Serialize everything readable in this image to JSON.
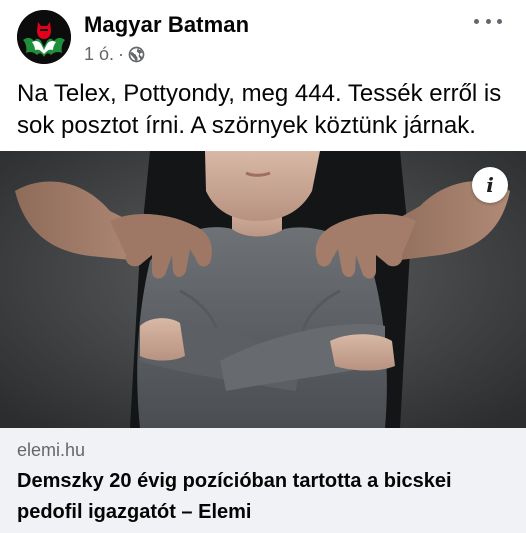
{
  "post": {
    "author": "Magyar Batman",
    "time": "1 ó.",
    "separator": "·",
    "privacy_icon": "globe-icon",
    "more_icon": "more-options-icon",
    "text": "Na Telex, Pottyondy, meg 444. Tessék erről is sok posztot írni. A szörnyek köztünk járnak."
  },
  "link_preview": {
    "image_description_icon": "info-icon",
    "info_glyph": "i",
    "domain": "elemi.hu",
    "title": "Demszky 20 évig pozícióban tartotta a bicskei pedofil igazgatót – Elemi"
  },
  "colors": {
    "text_primary": "#050505",
    "text_secondary": "#65676b",
    "link_bg": "#f0f2f5",
    "avatar_bg": "#0c0c0c",
    "avatar_red": "#e3001b",
    "avatar_green": "#1f8f3a"
  }
}
